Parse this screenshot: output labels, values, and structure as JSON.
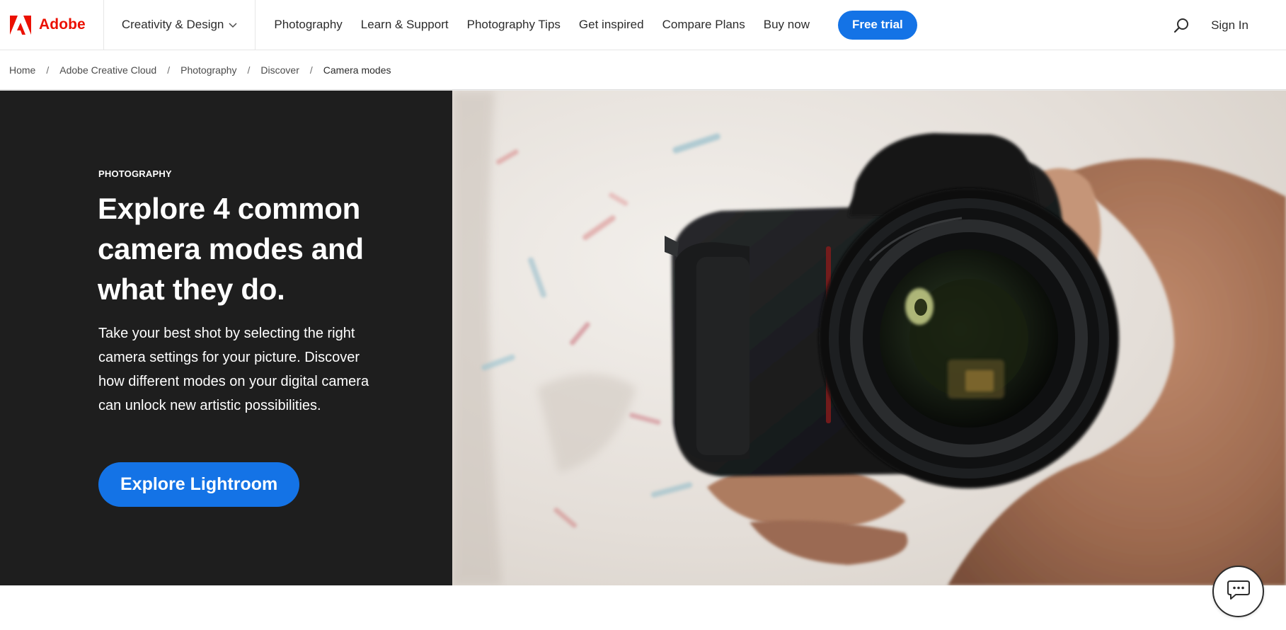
{
  "brand": {
    "name": "Adobe",
    "color": "#eb1000"
  },
  "nav": {
    "creativity_menu": "Creativity & Design",
    "links": [
      "Photography",
      "Learn & Support",
      "Photography Tips",
      "Get inspired",
      "Compare Plans",
      "Buy now"
    ],
    "cta": "Free trial",
    "signin": "Sign In",
    "accent": "#1473e6"
  },
  "breadcrumb": [
    "Home",
    "Adobe Creative Cloud",
    "Photography",
    "Discover",
    "Camera modes"
  ],
  "hero": {
    "eyebrow": "PHOTOGRAPHY",
    "headline": "Explore 4 common camera modes and what they do.",
    "body": "Take your best shot by selecting the right camera settings for your picture. Discover how different modes on your digital camera can unlock new artistic possibilities.",
    "cta": "Explore Lightroom",
    "panel_color": "#1e1e1e"
  },
  "icons": {
    "logo": "adobe-logo-icon",
    "chevron": "chevron-down-icon",
    "search": "search-icon",
    "chat": "chat-icon"
  }
}
